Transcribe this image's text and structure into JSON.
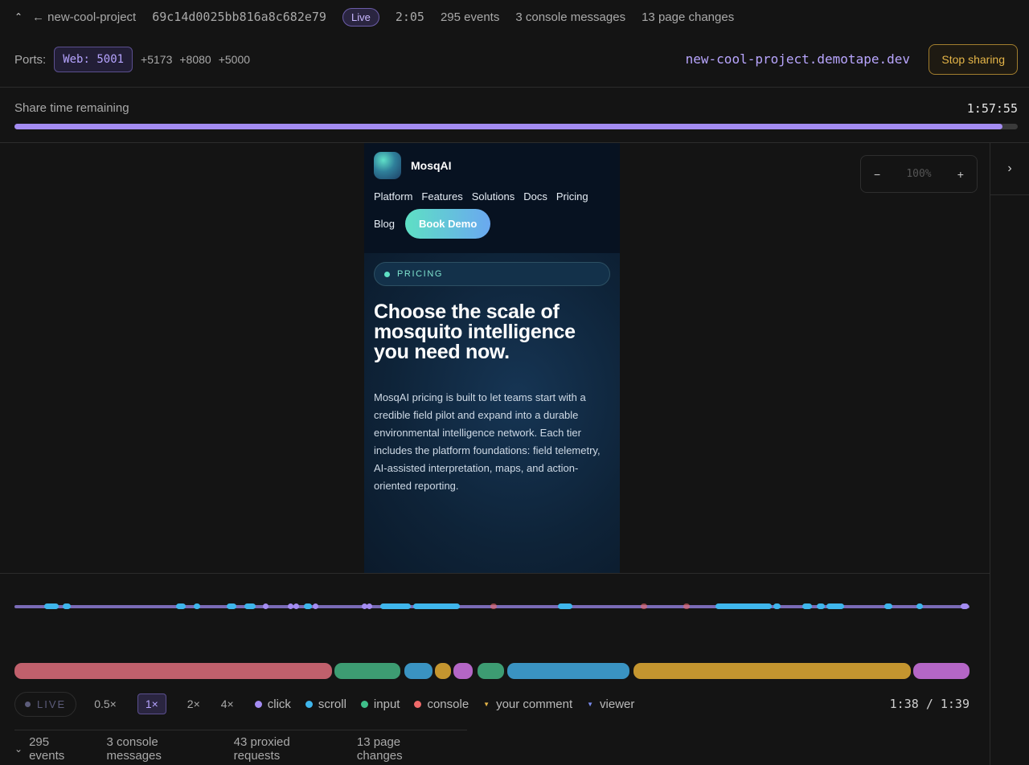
{
  "topbar": {
    "collapse_icon": "chevron-up-icon",
    "back_label": "← new-cool-project",
    "session_id": "69c14d0025bb816a8c682e79",
    "live_label": "Live",
    "elapsed": "2:05",
    "events": "295 events",
    "console": "3 console messages",
    "page_changes": "13 page changes"
  },
  "ports": {
    "label": "Ports:",
    "active": "Web: 5001",
    "others": [
      "+5173",
      "+8080",
      "+5000"
    ],
    "domain": "new-cool-project.demotape.dev",
    "stop_label": "Stop sharing"
  },
  "share": {
    "label": "Share time remaining",
    "time": "1:57:55",
    "progress_fraction": 0.985
  },
  "zoom": {
    "minus": "−",
    "level": "100%",
    "plus": "+"
  },
  "sidebar": {
    "expand_icon": "chevron-right-icon",
    "expand_glyph": "›"
  },
  "preview": {
    "brand": "MosqAI",
    "nav": [
      "Platform",
      "Features",
      "Solutions",
      "Docs",
      "Pricing",
      "Blog"
    ],
    "cta": "Book Demo",
    "tag": "PRICING",
    "headline": "Choose the scale of mosquito intelligence you need now.",
    "paragraph": "MosqAI pricing is built to let teams start with a credible field pilot and expand into a durable environmental intelligence network. Each tier includes the platform foundations: field telemetry, AI-assisted interpretation, maps, and action-oriented reporting."
  },
  "timeline": {
    "live_label": "LIVE",
    "speeds": [
      "0.5×",
      "1×",
      "2×",
      "4×"
    ],
    "active_speed": "1×",
    "legend": [
      {
        "label": "click",
        "color": "#a48cf2",
        "shape": "dot"
      },
      {
        "label": "scroll",
        "color": "#3fb6ec",
        "shape": "dot"
      },
      {
        "label": "input",
        "color": "#3fbf8a",
        "shape": "dot"
      },
      {
        "label": "console",
        "color": "#ef6a6a",
        "shape": "dot"
      },
      {
        "label": "your comment",
        "color": "#e5b548",
        "shape": "triangle"
      },
      {
        "label": "viewer",
        "color": "#7a8cf0",
        "shape": "triangle"
      }
    ],
    "current_time": "1:38",
    "separator": "/",
    "total_time": "1:39",
    "colors": {
      "track": "#7a6bb6",
      "seg_red": "#c0606c",
      "seg_green": "#3d9c72",
      "seg_blue": "#3a93c2",
      "seg_gold": "#c4952f",
      "seg_purple": "#b466c6"
    }
  },
  "footer": {
    "toggle_icon": "chevron-down-icon",
    "events": "295 events",
    "console": "3 console messages",
    "proxied": "43 proxied requests",
    "page_changes": "13 page changes"
  }
}
